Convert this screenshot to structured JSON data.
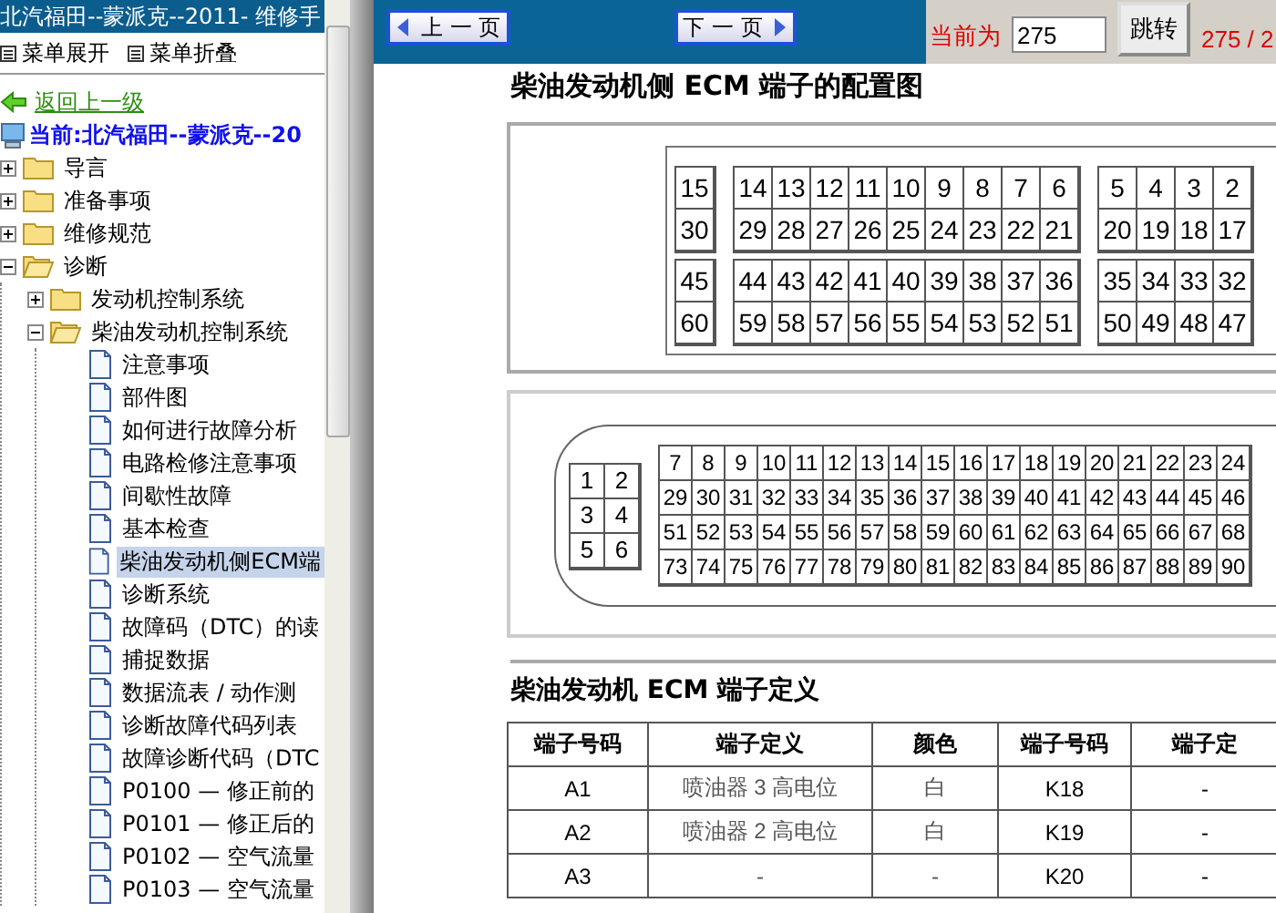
{
  "sidebar": {
    "title": "北汽福田--蒙派克--2011- 维修手",
    "toolbar": [
      {
        "label": "菜单展开"
      },
      {
        "label": "菜单折叠"
      }
    ],
    "back_link": "返回上一级",
    "current": "当前:北汽福田--蒙派克--20",
    "tree": [
      {
        "kind": "folder",
        "label": "导言",
        "expanded": false
      },
      {
        "kind": "folder",
        "label": "准备事项",
        "expanded": false
      },
      {
        "kind": "folder",
        "label": "维修规范",
        "expanded": false
      },
      {
        "kind": "folder",
        "label": "诊断",
        "expanded": true,
        "children": [
          {
            "kind": "folder",
            "label": "发动机控制系统",
            "expanded": false
          },
          {
            "kind": "folder",
            "label": "柴油发动机控制系统",
            "expanded": true,
            "children": [
              {
                "kind": "document",
                "label": "注意事项",
                "selected": false
              },
              {
                "kind": "document",
                "label": "部件图",
                "selected": false
              },
              {
                "kind": "document",
                "label": "如何进行故障分析",
                "selected": false
              },
              {
                "kind": "document",
                "label": "电路检修注意事项",
                "selected": false
              },
              {
                "kind": "document",
                "label": "间歇性故障",
                "selected": false
              },
              {
                "kind": "document",
                "label": "基本检查",
                "selected": false
              },
              {
                "kind": "document",
                "label": "柴油发动机侧ECM端",
                "selected": true
              },
              {
                "kind": "document",
                "label": "诊断系统",
                "selected": false
              },
              {
                "kind": "document",
                "label": "故障码（DTC）的读",
                "selected": false
              },
              {
                "kind": "document",
                "label": "捕捉数据",
                "selected": false
              },
              {
                "kind": "document",
                "label": "数据流表 / 动作测",
                "selected": false
              },
              {
                "kind": "document",
                "label": "诊断故障代码列表",
                "selected": false
              },
              {
                "kind": "document",
                "label": "故障诊断代码（DTC",
                "selected": false
              },
              {
                "kind": "document",
                "label": "P0100 — 修正前的",
                "selected": false
              },
              {
                "kind": "document",
                "label": "P0101 — 修正后的",
                "selected": false
              },
              {
                "kind": "document",
                "label": "P0102 — 空气流量",
                "selected": false
              },
              {
                "kind": "document",
                "label": "P0103 — 空气流量",
                "selected": false
              }
            ]
          }
        ]
      }
    ]
  },
  "nav": {
    "prev": "上 一 页",
    "next": "下 一 页",
    "current_label": "当前为",
    "page_input": "275",
    "jump_button": "跳转",
    "page_count": "275 / 2"
  },
  "document": {
    "title": "柴油发动机侧 ECM 端子的配置图",
    "connector_1": {
      "tiers": [
        {
          "blocks": [
            [
              [
                "15"
              ],
              [
                "30"
              ]
            ],
            [
              [
                "14",
                "13",
                "12",
                "11",
                "10",
                "9",
                "8",
                "7",
                "6"
              ],
              [
                "29",
                "28",
                "27",
                "26",
                "25",
                "24",
                "23",
                "22",
                "21"
              ]
            ],
            [
              [
                "5",
                "4",
                "3",
                "2"
              ],
              [
                "20",
                "19",
                "18",
                "17"
              ]
            ]
          ]
        },
        {
          "blocks": [
            [
              [
                "45"
              ],
              [
                "60"
              ]
            ],
            [
              [
                "44",
                "43",
                "42",
                "41",
                "40",
                "39",
                "38",
                "37",
                "36"
              ],
              [
                "59",
                "58",
                "57",
                "56",
                "55",
                "54",
                "53",
                "52",
                "51"
              ]
            ],
            [
              [
                "35",
                "34",
                "33",
                "32"
              ],
              [
                "50",
                "49",
                "48",
                "47"
              ]
            ]
          ]
        }
      ]
    },
    "connector_2": {
      "left_block": [
        [
          "1",
          "2"
        ],
        [
          "3",
          "4"
        ],
        [
          "5",
          "6"
        ]
      ],
      "main_block": [
        [
          "7",
          "8",
          "9",
          "10",
          "11",
          "12",
          "13",
          "14",
          "15",
          "16",
          "17",
          "18",
          "19",
          "20",
          "21",
          "22",
          "23",
          "24"
        ],
        [
          "29",
          "30",
          "31",
          "32",
          "33",
          "34",
          "35",
          "36",
          "37",
          "38",
          "39",
          "40",
          "41",
          "42",
          "43",
          "44",
          "45",
          "46"
        ],
        [
          "51",
          "52",
          "53",
          "54",
          "55",
          "56",
          "57",
          "58",
          "59",
          "60",
          "61",
          "62",
          "63",
          "64",
          "65",
          "66",
          "67",
          "68"
        ],
        [
          "73",
          "74",
          "75",
          "76",
          "77",
          "78",
          "79",
          "80",
          "81",
          "82",
          "83",
          "84",
          "85",
          "86",
          "87",
          "88",
          "89",
          "90"
        ]
      ]
    },
    "table_title": "柴油发动机 ECM 端子定义",
    "table": {
      "columns": [
        "端子号码",
        "端子定义",
        "颜色",
        "端子号码",
        "端子定"
      ],
      "rows": [
        [
          "A1",
          "喷油器 3 高电位",
          "白",
          "K18",
          "-"
        ],
        [
          "A2",
          "喷油器 2 高电位",
          "白",
          "K19",
          "-"
        ],
        [
          "A3",
          "-",
          "-",
          "K20",
          "-"
        ]
      ]
    }
  }
}
